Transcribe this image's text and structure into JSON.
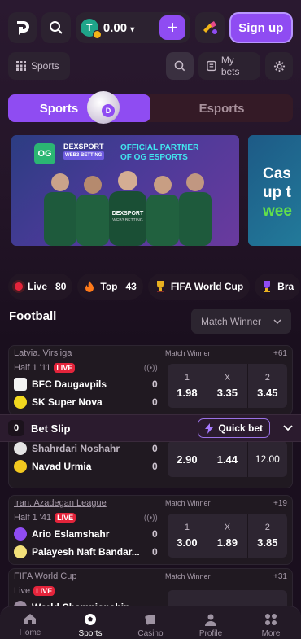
{
  "header": {
    "balance": "0.00",
    "balance_caret": "▾",
    "plus_label": "+",
    "signup_label": "Sign up"
  },
  "nav2": {
    "sports_label": "Sports",
    "mybets_label": "My bets"
  },
  "tabs": [
    {
      "label": "Sports",
      "active": true
    },
    {
      "label": "Esports",
      "active": false
    }
  ],
  "ball_badge": "D",
  "banner": {
    "brand": "DEXSPORT",
    "brand_sub": "WEB3 BETTING",
    "og": "OG",
    "headline1": "OFFICIAL PARTNER",
    "headline2": "OF OG ESPORTS",
    "shirt_text": "DEXSPORT",
    "shirt_sub": "WEB3 BETTING"
  },
  "banner2": {
    "line1": "Cas",
    "line2": "up t",
    "line3": "wee"
  },
  "chips": [
    {
      "label": "Live",
      "count": "80",
      "icon": "live-dot-icon"
    },
    {
      "label": "Top",
      "count": "43",
      "icon": "fire-icon"
    },
    {
      "label": "FIFA World Cup",
      "count": "",
      "icon": "trophy-icon"
    },
    {
      "label": "Bra",
      "count": "",
      "icon": "brazil-icon"
    }
  ],
  "section_title": "Football",
  "market_select": "Match Winner",
  "matches": [
    {
      "league": "Latvia. Virsliga",
      "market": "Match Winner",
      "more": "+61",
      "status": "Half 1 '11",
      "live": "LIVE",
      "team1": "BFC Daugavpils",
      "team2": "SK Super Nova",
      "score1": "0",
      "score2": "0",
      "odds": [
        {
          "l": "1",
          "v": "1.98"
        },
        {
          "l": "X",
          "v": "3.35"
        },
        {
          "l": "2",
          "v": "3.45"
        }
      ]
    },
    {
      "team1": "Shahrdari Noshahr",
      "team2": "Navad Urmia",
      "score1": "0",
      "score2": "0",
      "odds": [
        {
          "v": "2.90"
        },
        {
          "v": "1.44"
        },
        {
          "v": "12.00"
        }
      ]
    },
    {
      "league": "Iran. Azadegan League",
      "market": "Match Winner",
      "more": "+19",
      "status": "Half 1 '41",
      "live": "LIVE",
      "team1": "Ario Eslamshahr",
      "team2": "Palayesh Naft Bandar...",
      "score1": "0",
      "score2": "0",
      "odds": [
        {
          "l": "1",
          "v": "3.00"
        },
        {
          "l": "X",
          "v": "1.89"
        },
        {
          "l": "2",
          "v": "3.85"
        }
      ]
    },
    {
      "league": "FIFA World Cup",
      "market": "Match Winner",
      "more": "+31",
      "status": "Live",
      "live": "LIVE",
      "team1": "World Championship"
    }
  ],
  "betslip": {
    "count": "0",
    "title": "Bet Slip",
    "quick": "Quick bet"
  },
  "bottom_nav": [
    {
      "label": "Home",
      "active": false
    },
    {
      "label": "Sports",
      "active": true
    },
    {
      "label": "Casino",
      "active": false
    },
    {
      "label": "Profile",
      "active": false
    },
    {
      "label": "More",
      "active": false
    }
  ]
}
